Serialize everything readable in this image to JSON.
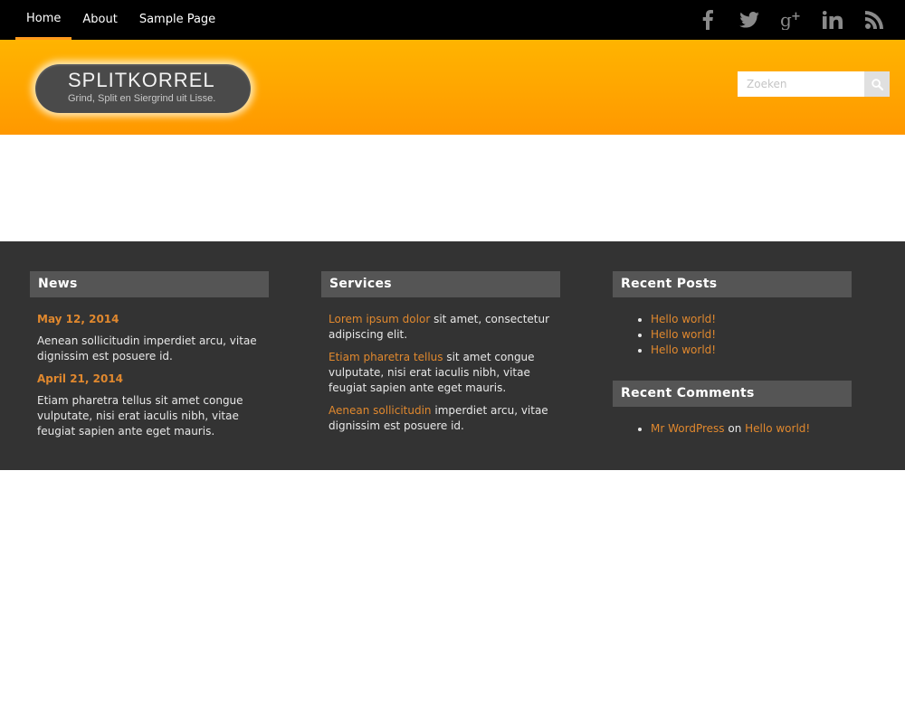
{
  "nav": {
    "items": [
      {
        "label": "Home"
      },
      {
        "label": "About"
      },
      {
        "label": "Sample Page"
      }
    ],
    "active_index": 0
  },
  "social": {
    "icons": [
      "facebook-icon",
      "twitter-icon",
      "google-plus-icon",
      "linkedin-icon",
      "rss-icon"
    ],
    "icon_color": "#8a8a8a"
  },
  "header": {
    "site_title": "SPLITKORREL",
    "tagline": "Grind, Split en Siergrind uit Lisse.",
    "search_placeholder": "Zoeken",
    "accent_color": "#ffa500"
  },
  "widgets": {
    "news": {
      "title": "News",
      "entries": [
        {
          "date": "May 12, 2014",
          "text": "Aenean sollicitudin imperdiet arcu, vitae dignissim est posuere id."
        },
        {
          "date": "April 21, 2014",
          "text": "Etiam pharetra tellus sit amet congue vulputate, nisi erat iaculis nibh, vitae feugiat sapien ante eget mauris."
        }
      ]
    },
    "services": {
      "title": "Services",
      "items": [
        {
          "link": "Lorem ipsum dolor",
          "text": " sit amet, consectetur adipiscing elit."
        },
        {
          "link": "Etiam pharetra tellus",
          "text": " sit amet congue vulputate, nisi erat iaculis nibh, vitae feugiat sapien ante eget mauris."
        },
        {
          "link": "Aenean sollicitudin",
          "text": " imperdiet arcu, vitae dignissim est posuere id."
        }
      ]
    },
    "recent_posts": {
      "title": "Recent Posts",
      "items": [
        "Hello world!",
        "Hello world!",
        "Hello world!"
      ]
    },
    "recent_comments": {
      "title": "Recent Comments",
      "items": [
        {
          "author": "Mr WordPress",
          "on": "on",
          "post": "Hello world!"
        }
      ]
    },
    "link_color": "#e0882e",
    "background": "#333333"
  }
}
